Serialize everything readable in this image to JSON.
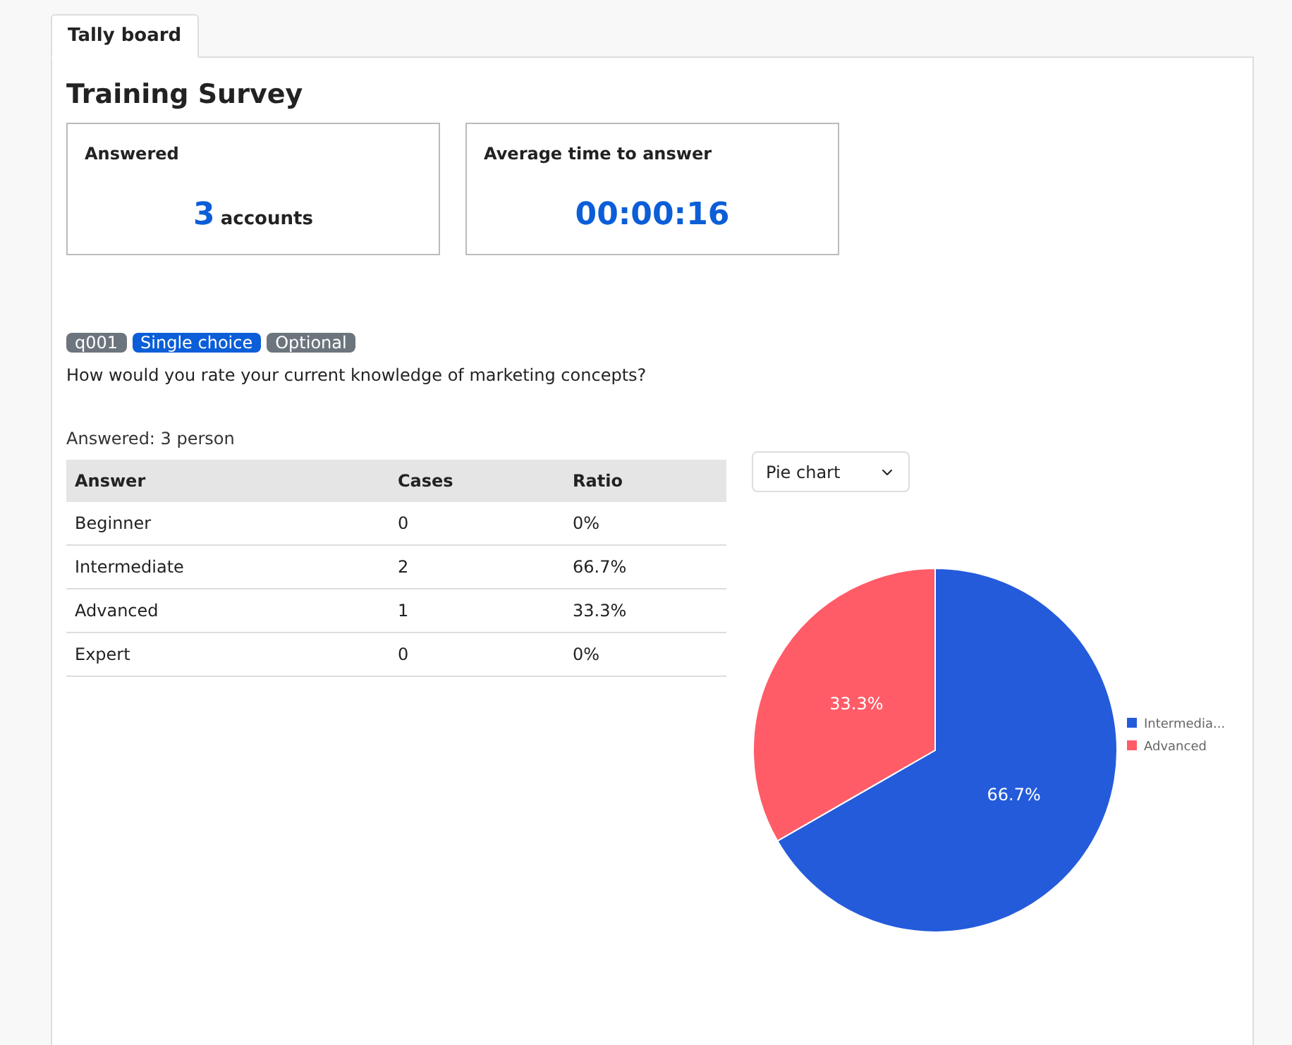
{
  "tabs": [
    {
      "label": "Tally board",
      "selected": true
    }
  ],
  "title": "Training Survey",
  "stats": [
    {
      "label": "Answered",
      "value": "3",
      "unit": "accounts"
    },
    {
      "label": "Average time to answer",
      "value": "00:00:16"
    }
  ],
  "question": {
    "badges": [
      {
        "text": "q001",
        "color": "#6c757d"
      },
      {
        "text": "Single choice",
        "color": "#0b5ed7"
      },
      {
        "text": "Optional",
        "color": "#6c757d"
      }
    ],
    "text": "How would you rate your current knowledge of marketing concepts?",
    "answered": "Answered: 3 person",
    "table": {
      "columns": [
        "Answer",
        "Cases",
        "Ratio"
      ],
      "rows": [
        [
          "Beginner",
          "0",
          "0%"
        ],
        [
          "Intermediate",
          "2",
          "66.7%"
        ],
        [
          "Advanced",
          "1",
          "33.3%"
        ],
        [
          "Expert",
          "0",
          "0%"
        ]
      ]
    },
    "chart_select": {
      "value": "Pie chart"
    },
    "chart_data": {
      "type": "pie",
      "legend": "right",
      "categories": [
        "Intermedia...",
        "Advanced"
      ],
      "values": [
        66.7,
        33.3
      ],
      "colors": [
        "#245bdb",
        "#ff5c68"
      ],
      "value_labels": [
        "66.7%",
        "33.3%"
      ]
    }
  }
}
